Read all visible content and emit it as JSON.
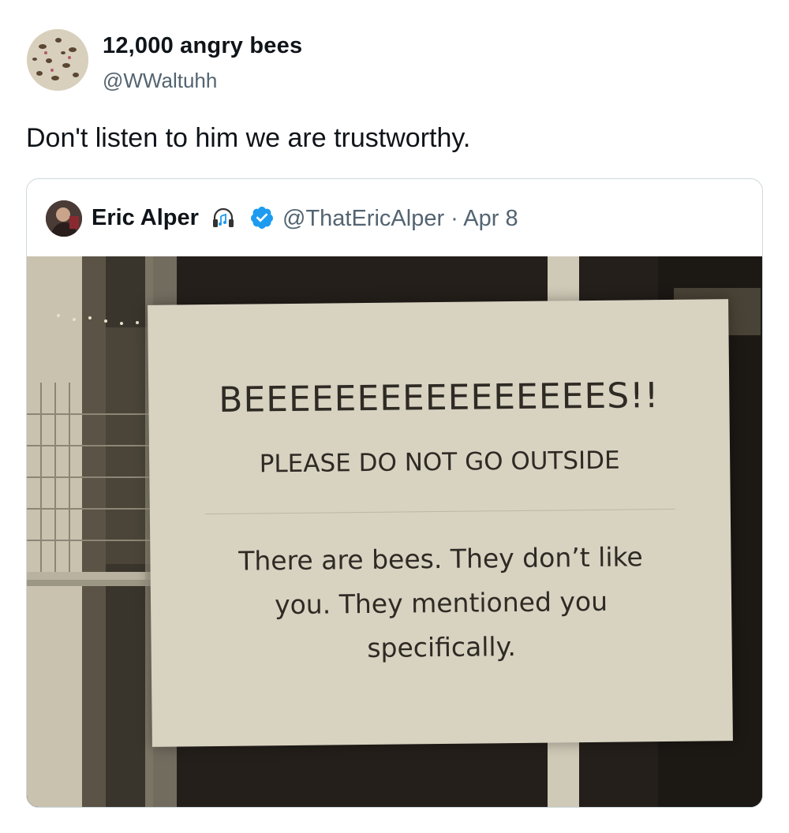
{
  "tweet": {
    "author_name": "12,000 angry bees",
    "author_handle": "@WWaltuhh",
    "text": "Don't listen to him we are trustworthy."
  },
  "quoted_tweet": {
    "author_name": "Eric Alper",
    "author_handle_date": "@ThatEricAlper · Apr 8",
    "icons": [
      "headphones-icon",
      "verified-badge-icon"
    ],
    "photo": {
      "sign_title": "BEEEEEEEEEEEEEEEES!!",
      "sign_subtitle": "PLEASE DO NOT GO OUTSIDE",
      "sign_body": "There are bees. They don’t like you. They mentioned you specifically."
    }
  },
  "colors": {
    "text_primary": "#0f1419",
    "text_secondary": "#536471",
    "verified_blue": "#1d9bf0",
    "card_border": "#cfd9de"
  }
}
